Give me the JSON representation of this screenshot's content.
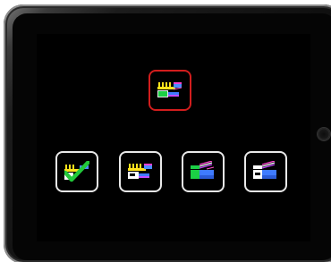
{
  "target_tile": {
    "icon": "clapperboard-rainbow-icon",
    "border_color": "#d21d1d"
  },
  "choice_tiles": [
    {
      "icon": "checkmark-icon",
      "border_color": "#e9e9e9",
      "check_color": "#22c83a"
    },
    {
      "icon": "clapperboard-rainbow-icon",
      "border_color": "#e9e9e9"
    },
    {
      "icon": "clapperboard-green-blue-icon",
      "border_color": "#e9e9e9"
    },
    {
      "icon": "clapperboard-white-blue-icon",
      "border_color": "#e9e9e9"
    }
  ],
  "colors": {
    "screen_background": "#000000",
    "device_frame": "#1a1a1a"
  }
}
